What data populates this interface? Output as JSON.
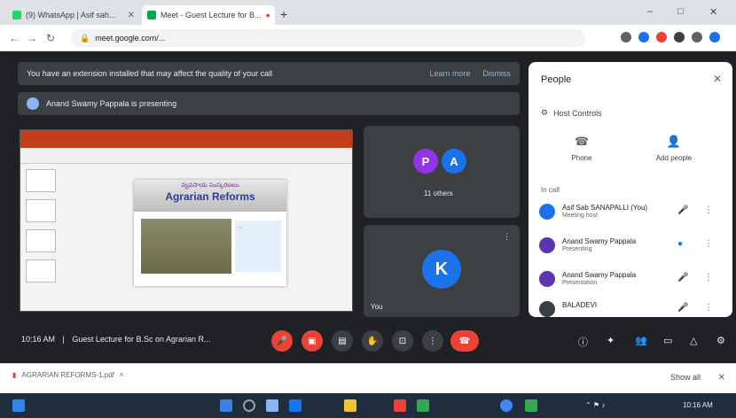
{
  "browser": {
    "tabs": [
      {
        "label": "(9) WhatsApp | Asif sah..."
      },
      {
        "label": "Meet - Guest Lecture for B..."
      }
    ],
    "new_tab": "+",
    "window_controls": {
      "minimize": "–",
      "maximize": "□",
      "close": "✕"
    },
    "url": "meet.google.com/..."
  },
  "meet": {
    "warning_banner": {
      "text": "You have an extension installed that may affect the quality of your call",
      "learn_more": "Learn more",
      "dismiss": "Dismiss"
    },
    "presenting_banner": {
      "text": "Anand Swamy Pappala is presenting"
    },
    "slide": {
      "subtitle": "వ్యవసాయ సంస్కరణలు",
      "title": "Agrarian Reforms",
      "note": "..."
    },
    "tiles": {
      "group": {
        "avatar1": "P",
        "avatar2": "A",
        "label": "11 others"
      },
      "single": {
        "avatar": "K",
        "label": "You"
      }
    },
    "people": {
      "title": "People",
      "close": "✕",
      "lock_chip": "Host Controls",
      "add_people": "Add people",
      "call": "Phone",
      "section": "In call",
      "participants": [
        {
          "name": "Asif Sab SANAPALLI (You)",
          "role": "Meeting host"
        },
        {
          "name": "Anand Swamy Pappala",
          "role": "Presenting"
        },
        {
          "name": "Anand Swamy Pappala",
          "role": "Presentation"
        },
        {
          "name": "BALADEVI",
          "role": ""
        }
      ]
    },
    "controlbar": {
      "time": "10:16 AM",
      "separator": "|",
      "meeting_name": "Guest Lecture for B.Sc on Agrarian R..."
    }
  },
  "downloadbar": {
    "file": "AGRARIAN REFORMS-1.pdf",
    "show_all": "Show all",
    "close": "✕"
  },
  "taskbar": {
    "clock": "10:16 AM"
  },
  "colors": {
    "meet_bg": "#202124",
    "tile_bg": "#3c4043",
    "end_call": "#ea4335",
    "avatar_purple": "#9334e6",
    "avatar_blue": "#1a73e8",
    "ppt_red": "#c43e1c"
  }
}
